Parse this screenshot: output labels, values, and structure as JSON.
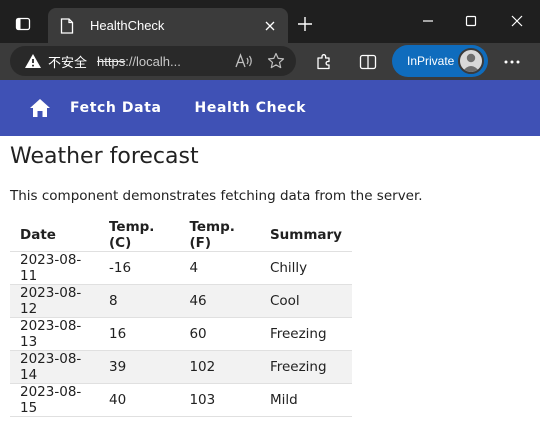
{
  "browser": {
    "tab_title": "HealthCheck",
    "insecure_label": "不安全",
    "url_scheme": "https",
    "url_rest": "://localh...",
    "inprivate_label": "InPrivate"
  },
  "nav": {
    "items": [
      {
        "label": "Fetch Data"
      },
      {
        "label": "Health Check"
      }
    ],
    "color": "#3f51b5"
  },
  "page": {
    "title": "Weather forecast",
    "description": "This component demonstrates fetching data from the server."
  },
  "table": {
    "headers": [
      "Date",
      "Temp. (C)",
      "Temp. (F)",
      "Summary"
    ],
    "rows": [
      [
        "2023-08-11",
        "-16",
        "4",
        "Chilly"
      ],
      [
        "2023-08-12",
        "8",
        "46",
        "Cool"
      ],
      [
        "2023-08-13",
        "16",
        "60",
        "Freezing"
      ],
      [
        "2023-08-14",
        "39",
        "102",
        "Freezing"
      ],
      [
        "2023-08-15",
        "40",
        "103",
        "Mild"
      ]
    ]
  },
  "icons": {
    "tab_actions": "tab-actions-icon",
    "favicon": "page-icon",
    "close": "close-icon",
    "new_tab": "plus-icon",
    "minimize": "minimize-icon",
    "maximize": "maximize-icon",
    "window_close": "window-close-icon",
    "warning": "warning-icon",
    "read_aloud": "read-aloud-icon",
    "favorite": "star-icon",
    "extensions": "puzzle-icon",
    "split_screen": "split-screen-icon",
    "more": "more-icon",
    "home": "home-icon"
  }
}
